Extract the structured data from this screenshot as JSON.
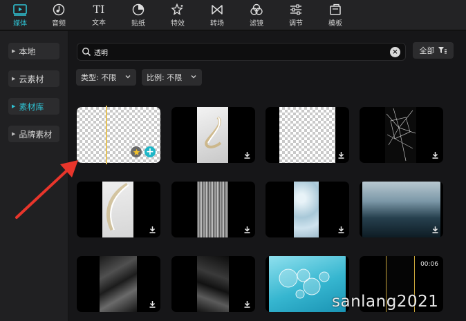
{
  "tabs": [
    {
      "label": "媒体",
      "icon": "media-icon",
      "active": true
    },
    {
      "label": "音频",
      "icon": "audio-icon"
    },
    {
      "label": "文本",
      "icon": "text-icon"
    },
    {
      "label": "贴纸",
      "icon": "sticker-icon"
    },
    {
      "label": "特效",
      "icon": "effects-icon"
    },
    {
      "label": "转场",
      "icon": "transition-icon"
    },
    {
      "label": "滤镜",
      "icon": "filter-icon"
    },
    {
      "label": "调节",
      "icon": "adjust-icon"
    },
    {
      "label": "模板",
      "icon": "template-icon"
    }
  ],
  "text_icon_glyph": "TI",
  "sidebar": {
    "items": [
      {
        "label": "本地"
      },
      {
        "label": "云素材"
      },
      {
        "label": "素材库",
        "active": true
      },
      {
        "label": "品牌素材"
      }
    ]
  },
  "search": {
    "value": "透明"
  },
  "filter": {
    "all_label": "全部"
  },
  "dropdowns": [
    {
      "label": "类型: 不限"
    },
    {
      "label": "比例: 不限"
    }
  ],
  "grid": [
    {
      "type": "transparent",
      "favorite": true,
      "add": true
    },
    {
      "type": "glass-ribbon"
    },
    {
      "type": "transparent"
    },
    {
      "type": "cracked-glass"
    },
    {
      "type": "glass-ribbon"
    },
    {
      "type": "striped-glass"
    },
    {
      "type": "frosted-blue"
    },
    {
      "type": "rain-window"
    },
    {
      "type": "plastic-wrap"
    },
    {
      "type": "plastic-wrap"
    },
    {
      "type": "water-drops"
    },
    {
      "type": "gold-frame",
      "duration": "00:06"
    }
  ],
  "watermark": "sanlang2021",
  "colors": {
    "accent": "#2fc2d3",
    "arrow": "#e8352b",
    "playhead": "#e6c35a"
  }
}
